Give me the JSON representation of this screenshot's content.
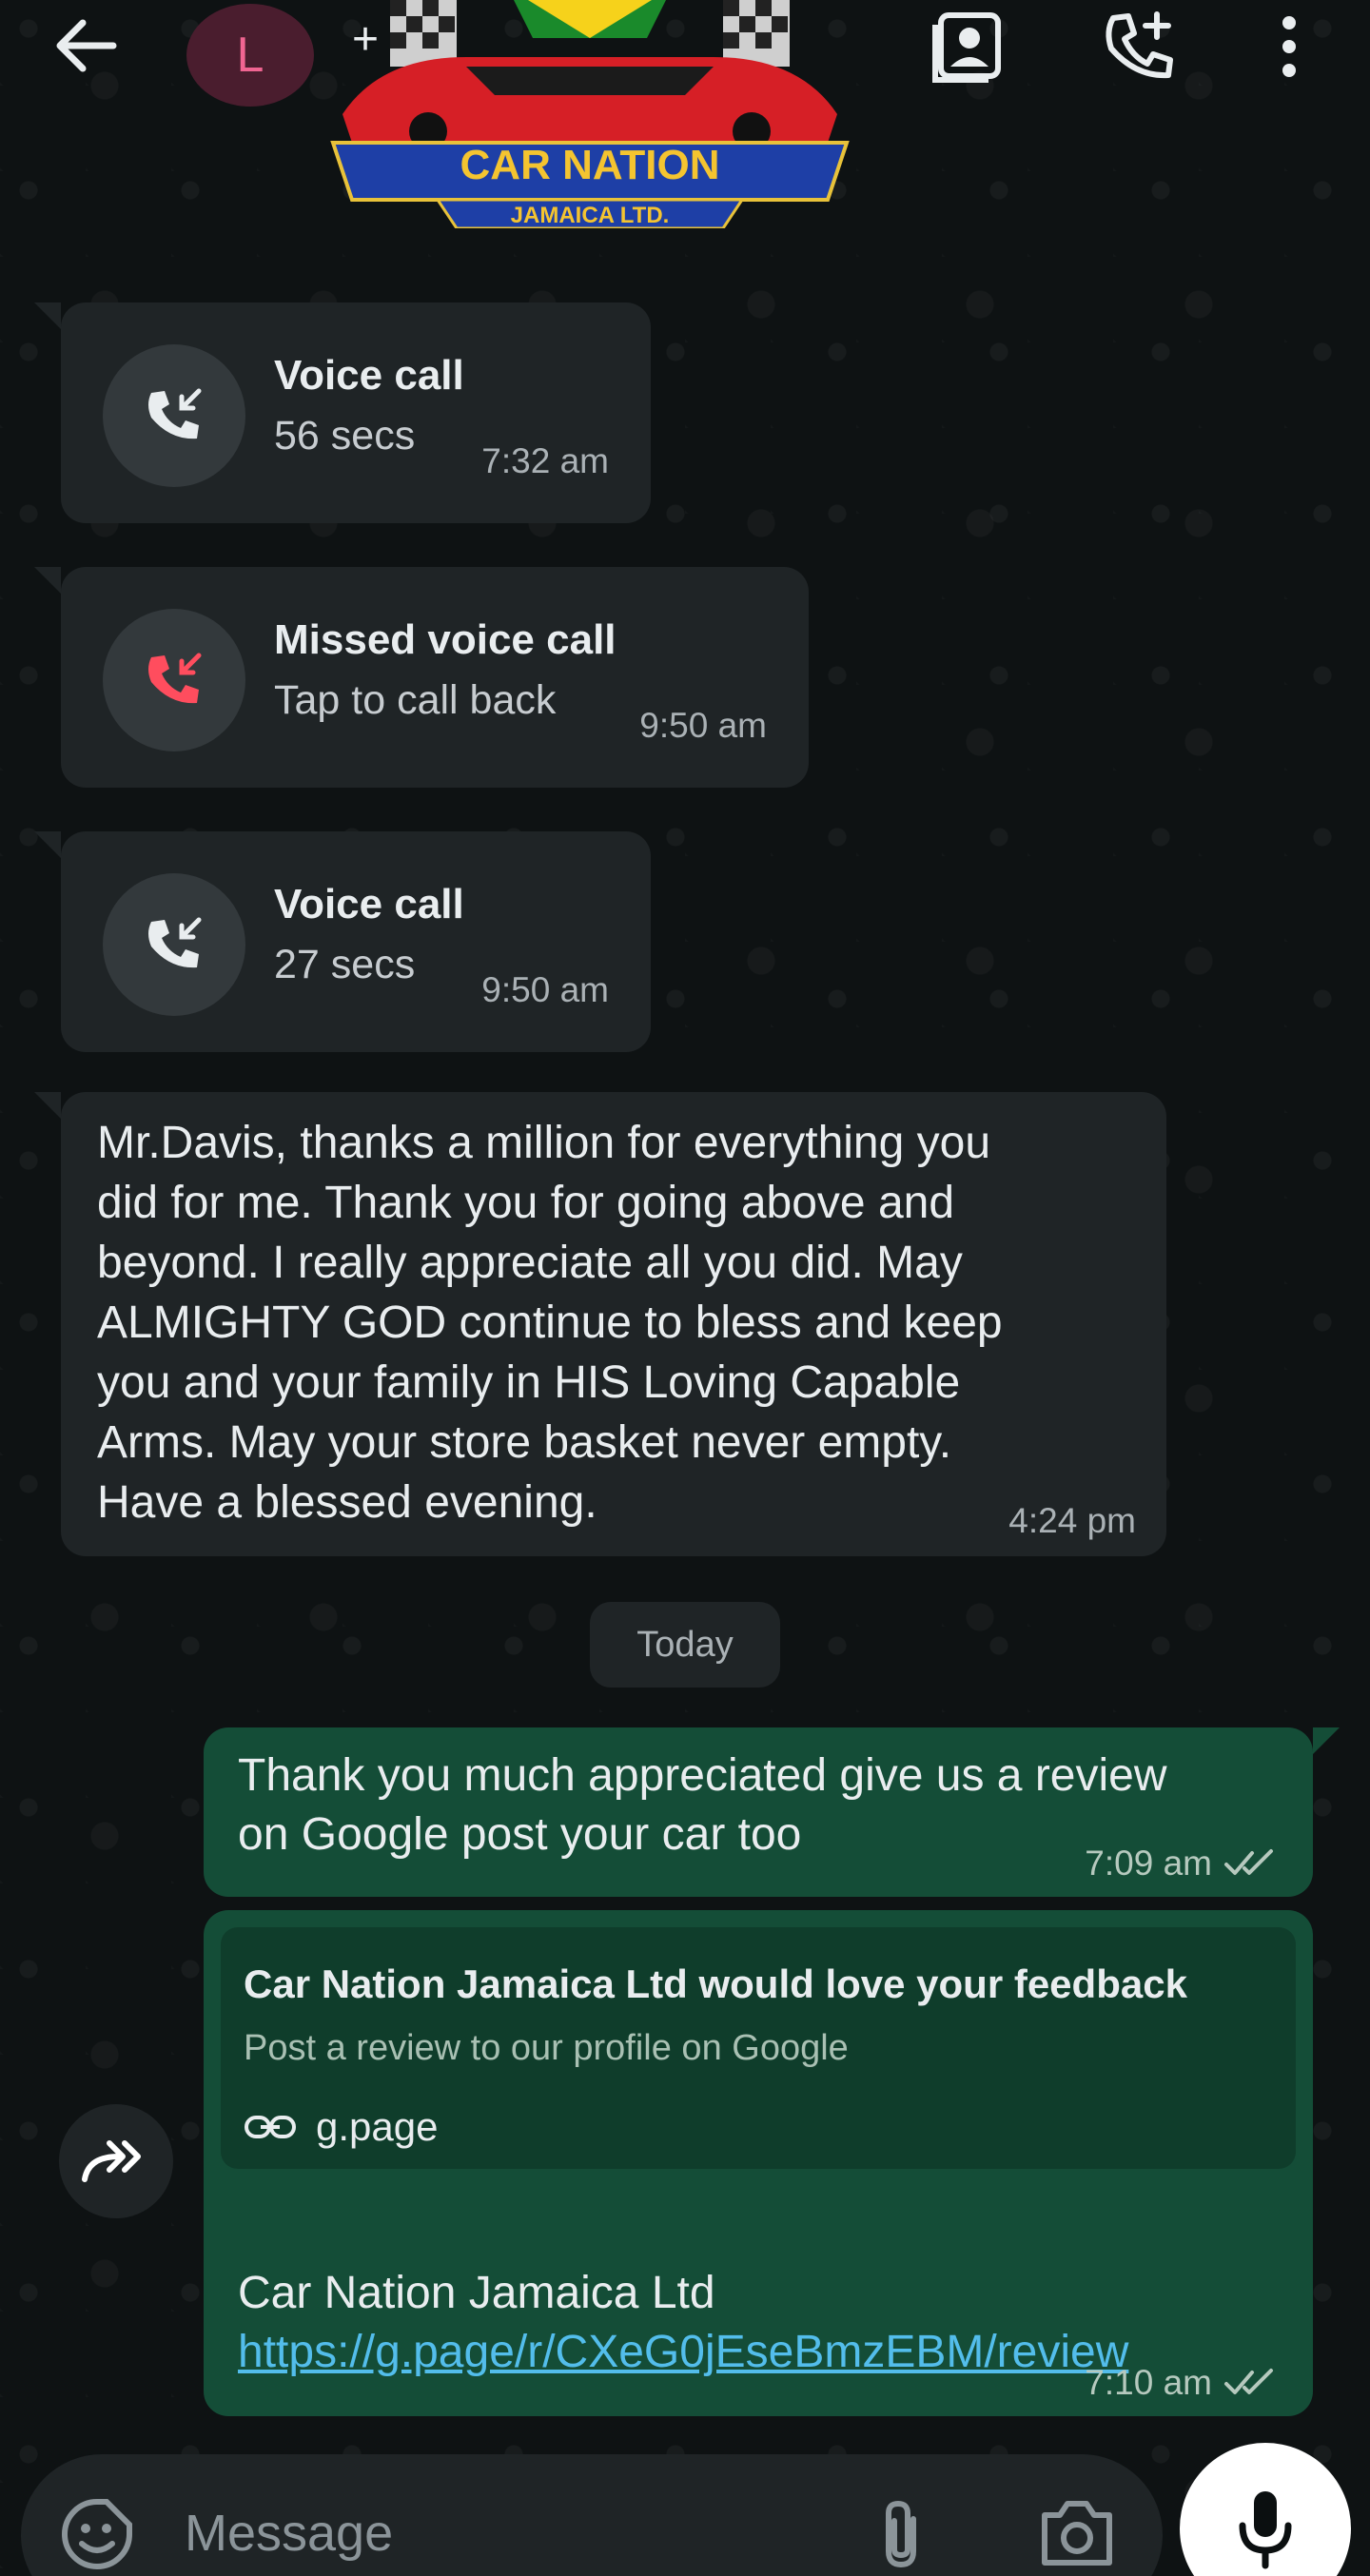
{
  "header": {
    "avatar_letter": "L",
    "plus": "+",
    "logo_text_1": "CAR NATION",
    "logo_text_2": "JAMAICA LTD."
  },
  "calls": [
    {
      "title": "Voice call",
      "sub": "56 secs",
      "time": "7:32 am",
      "type": "incoming",
      "icon_color": "#e9edef"
    },
    {
      "title": "Missed voice call",
      "sub": "Tap to call back",
      "time": "9:50 am",
      "type": "missed",
      "icon_color": "#ff4d5e"
    },
    {
      "title": "Voice call",
      "sub": "27 secs",
      "time": "9:50 am",
      "type": "incoming",
      "icon_color": "#e9edef"
    }
  ],
  "incoming_message": {
    "text": "Mr.Davis, thanks a million for everything you\ndid for me. Thank you for going above and\nbeyond.  I really appreciate all you did. May\nALMIGHTY GOD continue to bless and keep\nyou and your family in HIS Loving Capable\nArms. May your store basket never empty.\nHave a blessed evening.",
    "time": "4:24 pm"
  },
  "day_divider": "Today",
  "outgoing": [
    {
      "text": "Thank you much appreciated give us a review on Google post your car too",
      "time": "7:09 am"
    },
    {
      "preview_title": "Car Nation Jamaica Ltd would love your feedback",
      "preview_desc": "Post a review to our profile on Google",
      "preview_domain": "g.page",
      "text_prefix": "Car Nation Jamaica Ltd ",
      "link": "https://g.page/r/CXeG0jEseBmzEBM/review",
      "time": "7:10 am"
    }
  ],
  "composer": {
    "placeholder": "Message"
  },
  "colors": {
    "outgoing_bubble": "#144d37",
    "incoming_bubble": "#1f2426",
    "link": "#53bdeb",
    "missed": "#ff4d5e"
  }
}
